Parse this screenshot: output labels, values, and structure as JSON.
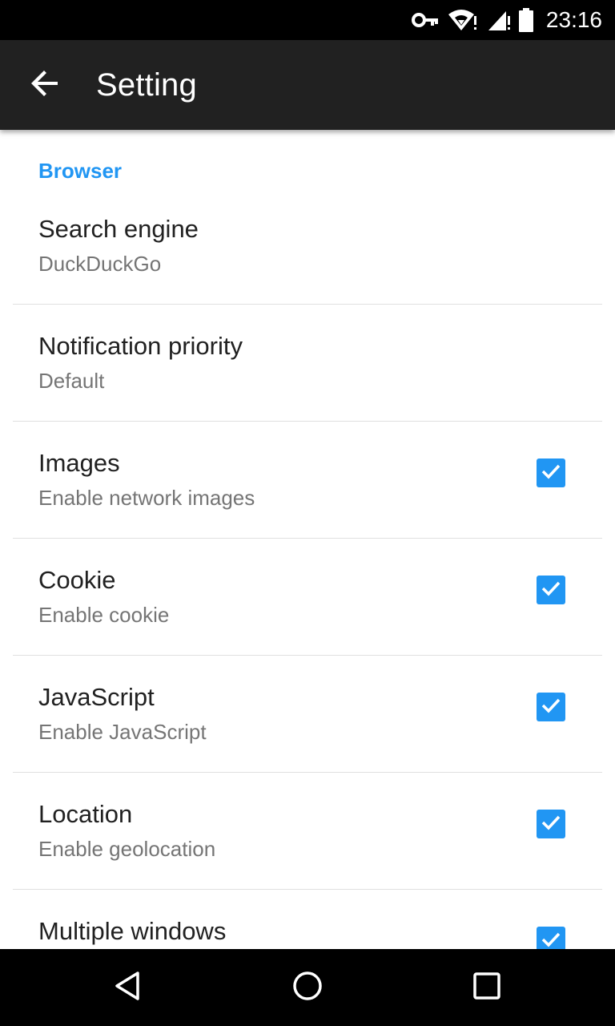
{
  "status_bar": {
    "time": "23:16",
    "icons": [
      "vpn-key-icon",
      "wifi-alert-icon",
      "cell-signal-alert-icon",
      "battery-full-icon"
    ]
  },
  "app_bar": {
    "back_icon": "arrow-back-icon",
    "title": "Setting"
  },
  "section": {
    "header": "Browser"
  },
  "preferences": [
    {
      "title": "Search engine",
      "summary": "DuckDuckGo",
      "checkbox": null
    },
    {
      "title": "Notification priority",
      "summary": "Default",
      "checkbox": null
    },
    {
      "title": "Images",
      "summary": "Enable network images",
      "checkbox": true
    },
    {
      "title": "Cookie",
      "summary": "Enable cookie",
      "checkbox": true
    },
    {
      "title": "JavaScript",
      "summary": "Enable JavaScript",
      "checkbox": true
    },
    {
      "title": "Location",
      "summary": "Enable geolocation",
      "checkbox": true
    },
    {
      "title": "Multiple windows",
      "summary": "",
      "checkbox": true
    }
  ],
  "nav_bar": {
    "icons": [
      "back-triangle-icon",
      "home-circle-icon",
      "recents-square-icon"
    ]
  },
  "colors": {
    "accent": "#2196F3",
    "app_bar": "#212121",
    "status_bar": "#000000",
    "nav_bar": "#000000",
    "title_text": "#212121",
    "summary_text": "#757575"
  }
}
